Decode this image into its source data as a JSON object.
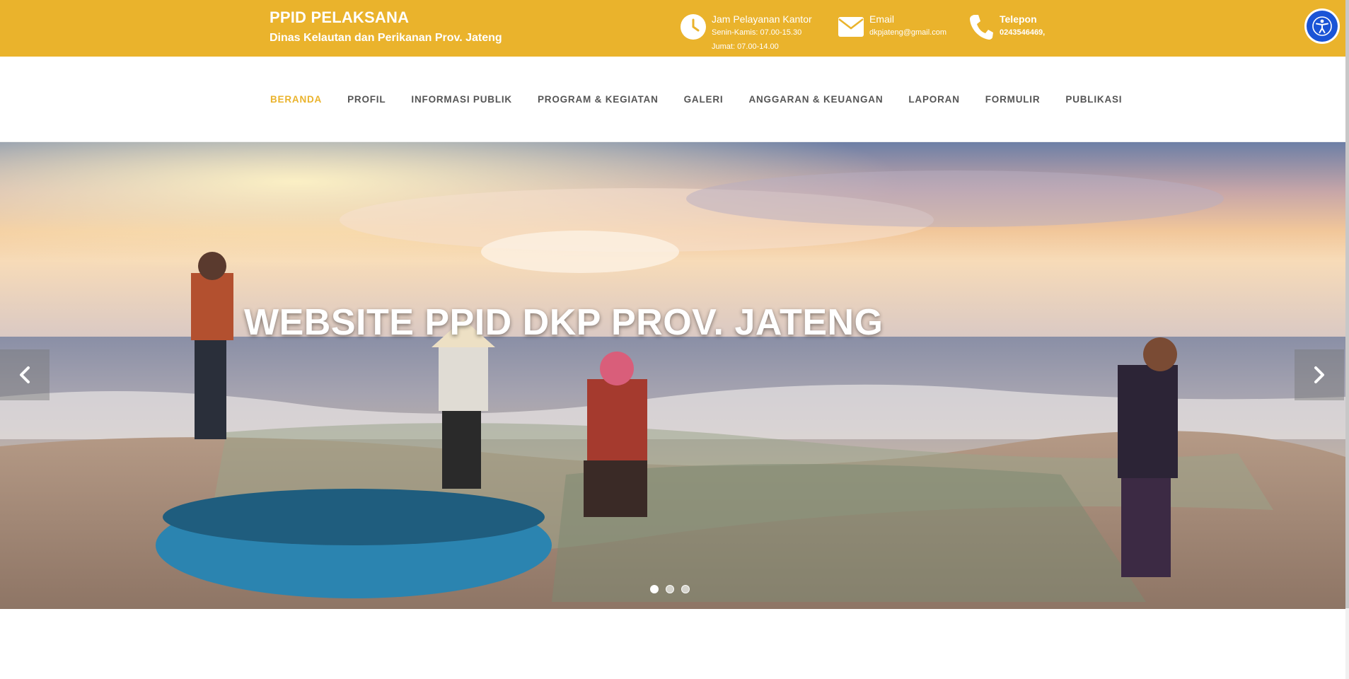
{
  "header": {
    "title": "PPID PELAKSANA",
    "subtitle": "Dinas Kelautan dan Perikanan Prov. Jateng",
    "hours": {
      "label": "Jam Pelayanan Kantor",
      "line1": "Senin-Kamis: 07.00-15.30",
      "line2": "Jumat: 07.00-14.00",
      "icon": "clock-icon"
    },
    "email": {
      "label": "Email",
      "value": "dkpjateng@gmail.com",
      "icon": "envelope-icon"
    },
    "phone": {
      "label": "Telepon",
      "value": "0243546469,",
      "icon": "phone-icon"
    },
    "accessibility_icon": "accessibility-icon"
  },
  "nav": {
    "items": [
      {
        "label": "BERANDA",
        "active": true
      },
      {
        "label": "PROFIL"
      },
      {
        "label": "INFORMASI PUBLIK"
      },
      {
        "label": "PROGRAM & KEGIATAN"
      },
      {
        "label": "GALERI"
      },
      {
        "label": "ANGGARAN & KEUANGAN"
      },
      {
        "label": "LAPORAN"
      },
      {
        "label": "FORMULIR"
      },
      {
        "label": "PUBLIKASI"
      }
    ]
  },
  "hero": {
    "title": "WEBSITE PPID DKP PROV. JATENG",
    "slide_count": 3,
    "active_slide": 1,
    "prev_icon": "chevron-left-icon",
    "next_icon": "chevron-right-icon"
  },
  "colors": {
    "brand": "#EAB32C",
    "nav_text": "#555555",
    "accessibility": "#1a54d6"
  }
}
